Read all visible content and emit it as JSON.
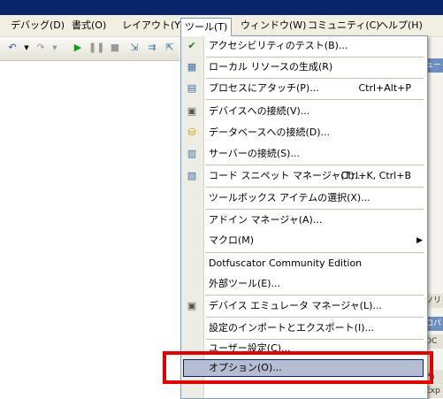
{
  "menubar": {
    "items": [
      "デバッグ(D)",
      "書式(O)",
      "レイアウト(Y)",
      "ツール(T)",
      "ウィンドウ(W)",
      "コミュニティ(C)",
      "ヘルプ(H)"
    ],
    "active": "ツール(T)"
  },
  "tools_menu": {
    "items": [
      {
        "label": "アクセシビリティのテスト(B)...",
        "shortcut": "",
        "icon": "accessibility-check-icon"
      },
      {
        "label": "ローカル リソースの生成(R)",
        "shortcut": "",
        "icon": "resource-gen-icon"
      },
      {
        "label": "プロセスにアタッチ(P)...",
        "shortcut": "Ctrl+Alt+P",
        "icon": "attach-process-icon"
      },
      {
        "label": "デバイスへの接続(V)...",
        "shortcut": "",
        "icon": "device-connect-icon"
      },
      {
        "label": "データベースへの接続(D)...",
        "shortcut": "",
        "icon": "database-connect-icon"
      },
      {
        "label": "サーバーの接続(S)...",
        "shortcut": "",
        "icon": "server-connect-icon"
      },
      {
        "label": "コード スニペット マネージャ(T)...",
        "shortcut": "Ctrl+K, Ctrl+B",
        "icon": "snippet-manager-icon"
      },
      {
        "label": "ツールボックス アイテムの選択(X)...",
        "shortcut": "",
        "icon": ""
      },
      {
        "label": "アドイン マネージャ(A)...",
        "shortcut": "",
        "icon": ""
      },
      {
        "label": "マクロ(M)",
        "shortcut": "",
        "icon": "",
        "submenu": true
      },
      {
        "label": "Dotfuscator Community Edition",
        "shortcut": "",
        "icon": ""
      },
      {
        "label": "外部ツール(E)...",
        "shortcut": "",
        "icon": ""
      },
      {
        "label": "デバイス エミュレータ マネージャ(L)...",
        "shortcut": "",
        "icon": "emulator-manager-icon"
      },
      {
        "label": "設定のインポートとエクスポート(I)...",
        "shortcut": "",
        "icon": ""
      },
      {
        "label": "ユーザー設定(C)...",
        "shortcut": "",
        "icon": ""
      },
      {
        "label": "オプション(O)...",
        "shortcut": "",
        "icon": "",
        "selected": true
      }
    ]
  },
  "right_panel": {
    "tabs": [
      "ュー",
      "ソリ",
      "ロパ",
      "OC",
      "Pa",
      "Exp"
    ]
  }
}
